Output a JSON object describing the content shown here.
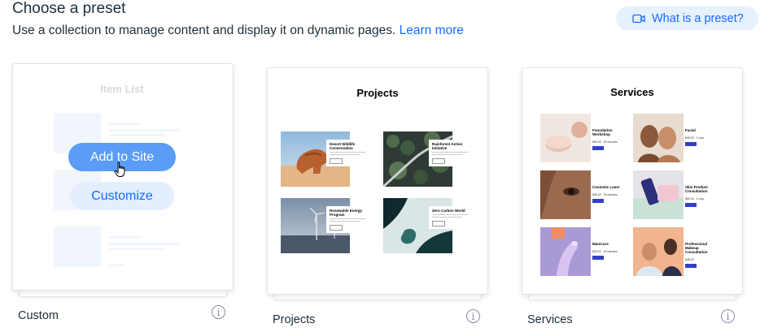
{
  "header": {
    "title": "Choose a preset",
    "subtitle": "Use a collection to manage content and display it on dynamic pages.",
    "learn_more": "Learn more",
    "help_button": "What is a preset?"
  },
  "cards": {
    "custom": {
      "label": "Custom",
      "preview_title": "Item List",
      "add_button": "Add to Site",
      "customize_button": "Customize"
    },
    "projects": {
      "label": "Projects",
      "preview_title": "Projects",
      "items": [
        {
          "title": "Desert Wildlife Conservation",
          "image": "desert-rock"
        },
        {
          "title": "Rainforest Action Initiative",
          "image": "forest-aerial"
        },
        {
          "title": "Renewable Energy Program",
          "image": "wind-turbines"
        },
        {
          "title": "Zero Carbon World",
          "image": "ice-water"
        }
      ]
    },
    "services": {
      "label": "Services",
      "preview_title": "Services",
      "items": [
        {
          "title": "Foundation Workshop",
          "image": "cosmetic-powder"
        },
        {
          "title": "Facial",
          "image": "models-smiling"
        },
        {
          "title": "Cosmetic Laser",
          "image": "skin-closeup"
        },
        {
          "title": "Skin Product Consultation",
          "image": "product-bottles"
        },
        {
          "title": "Manicure",
          "image": "nails"
        },
        {
          "title": "Professional Makeup Consultation",
          "image": "makeup-artist"
        }
      ]
    }
  },
  "icons": {
    "help": "video-icon",
    "info": "info-icon",
    "cursor": "hand-pointer-icon"
  },
  "colors": {
    "link": "#116dff",
    "help_bg": "#e7f0ff",
    "add_button_bg": "#5a9cf8",
    "customize_button_bg": "#e4eeff",
    "service_button": "#3340c8"
  }
}
